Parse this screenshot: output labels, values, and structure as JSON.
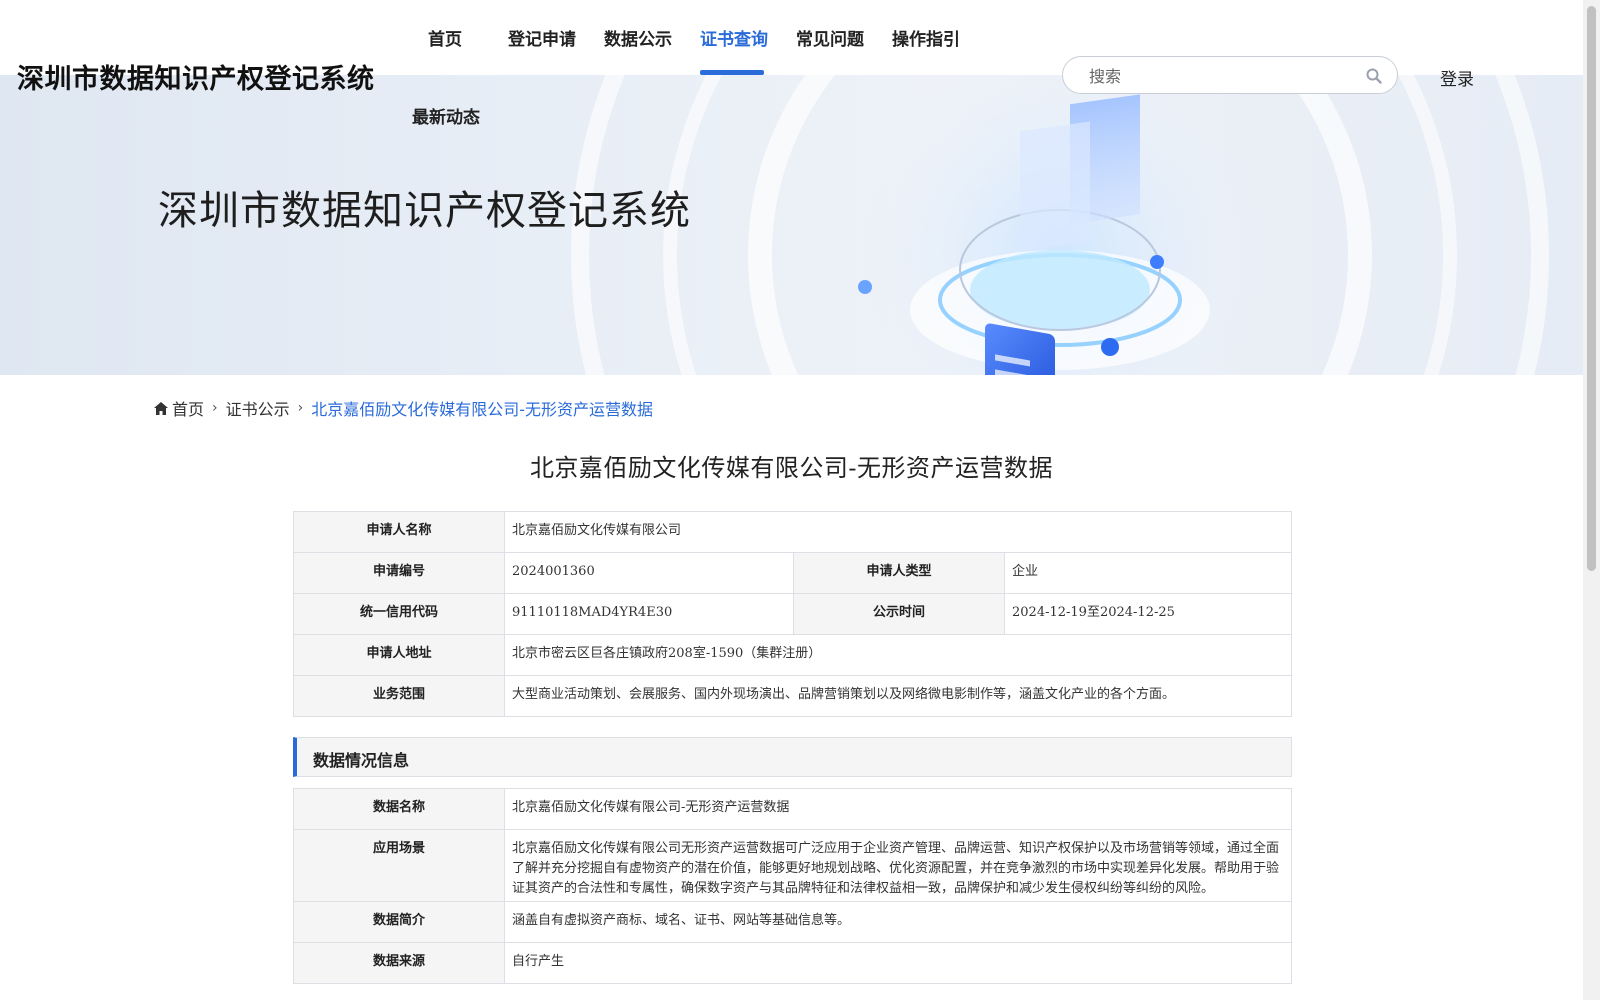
{
  "site": {
    "title": "深圳市数据知识产权登记系统"
  },
  "nav": {
    "items": [
      {
        "label": "首页"
      },
      {
        "label": "登记申请"
      },
      {
        "label": "数据公示"
      },
      {
        "label": "证书查询"
      },
      {
        "label": "常见问题"
      },
      {
        "label": "操作指引"
      },
      {
        "label": "最新动态"
      }
    ],
    "active_index": 3
  },
  "search": {
    "placeholder": "搜索"
  },
  "login": {
    "label": "登录"
  },
  "banner": {
    "title": "深圳市数据知识产权登记系统"
  },
  "breadcrumb": {
    "home": "首页",
    "section": "证书公示",
    "current": "北京嘉佰励文化传媒有限公司-无形资产运营数据"
  },
  "page": {
    "title": "北京嘉佰励文化传媒有限公司-无形资产运营数据"
  },
  "applicant": {
    "name_label": "申请人名称",
    "name": "北京嘉佰励文化传媒有限公司",
    "number_label": "申请编号",
    "number": "2024001360",
    "type_label": "申请人类型",
    "type": "企业",
    "credit_label": "统一信用代码",
    "credit": "91110118MAD4YR4E30",
    "period_label": "公示时间",
    "period": "2024-12-19至2024-12-25",
    "address_label": "申请人地址",
    "address": "北京市密云区巨各庄镇政府208室-1590（集群注册）",
    "scope_label": "业务范围",
    "scope": "大型商业活动策划、会展服务、国内外现场演出、品牌营销策划以及网络微电影制作等，涵盖文化产业的各个方面。"
  },
  "data_section": {
    "title": "数据情况信息",
    "name_label": "数据名称",
    "name": "北京嘉佰励文化传媒有限公司-无形资产运营数据",
    "scene_label": "应用场景",
    "scene": "北京嘉佰励文化传媒有限公司无形资产运营数据可广泛应用于企业资产管理、品牌运营、知识产权保护以及市场营销等领域，通过全面了解并充分挖掘自有虚物资产的潜在价值，能够更好地规划战略、优化资源配置，并在竞争激烈的市场中实现差异化发展。帮助用于验证其资产的合法性和专属性，确保数字资产与其品牌特征和法律权益相一致，品牌保护和减少发生侵权纠纷等纠纷的风险。",
    "intro_label": "数据简介",
    "intro": "涵盖自有虚拟资产商标、域名、证书、网站等基础信息等。",
    "source_label": "数据来源",
    "source": "自行产生"
  },
  "colors": {
    "accent": "#2a6bd9",
    "label_bg": "#f5f5f5",
    "border": "#dcdfe4"
  }
}
